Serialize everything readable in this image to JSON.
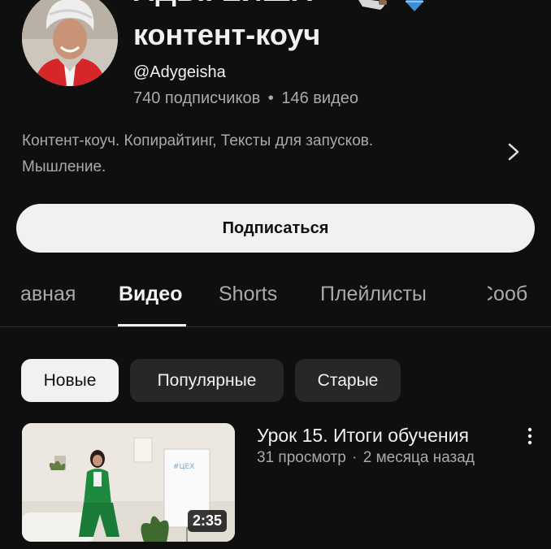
{
  "channel": {
    "title_top": "АДЫГЕЙША",
    "title_main": "контент-коуч",
    "handle": "@Adygeisha",
    "subscribers": "740 подписчиков",
    "videos_count": "146 видео",
    "separator": "•",
    "description_line1": "Контент-коуч. Копирайтинг, Тексты для запусков.",
    "description_line2": "Мышление."
  },
  "subscribe_label": "Подписаться",
  "tabs": [
    {
      "label": "Главная",
      "visible_label": "авная",
      "active": false
    },
    {
      "label": "Видео",
      "active": true
    },
    {
      "label": "Shorts",
      "active": false
    },
    {
      "label": "Плейлисты",
      "active": false
    },
    {
      "label": "Сообщество",
      "visible_label": "Сооб",
      "active": false
    }
  ],
  "filters": [
    {
      "label": "Новые",
      "selected": true
    },
    {
      "label": "Популярные",
      "selected": false
    },
    {
      "label": "Старые",
      "selected": false
    }
  ],
  "video": {
    "title": "Урок 15. Итоги обучения",
    "views": "31 просмотр",
    "age": "2 месяца назад",
    "meta_separator": "·",
    "duration": "2:35",
    "board_text": "#ЦЕХ"
  },
  "colors": {
    "background": "#0f0f0f",
    "text_primary": "#f1f1f1",
    "text_secondary": "#aaaaaa",
    "chip_bg": "#272727",
    "suit_green": "#1d8a3f",
    "avatar_red": "#d6262a"
  },
  "icons": [
    "chevron-right-icon",
    "more-vert-icon",
    "knife-emoji-icon",
    "gem-emoji-icon"
  ]
}
